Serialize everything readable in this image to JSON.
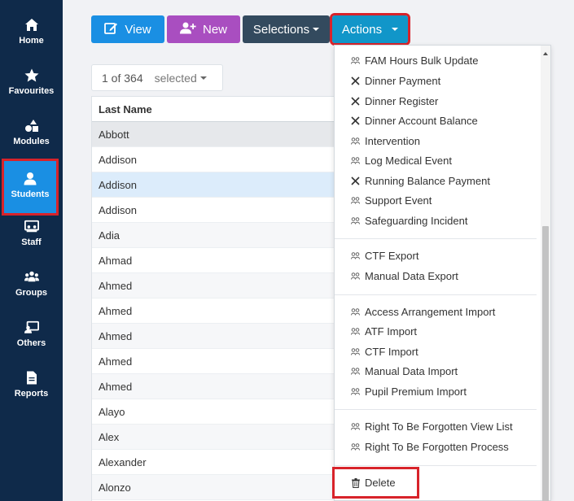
{
  "sidebar": {
    "items": [
      {
        "label": "Home",
        "icon": "home-icon"
      },
      {
        "label": "Favourites",
        "icon": "star-icon"
      },
      {
        "label": "Modules",
        "icon": "shapes-icon"
      },
      {
        "label": "Students",
        "icon": "user-icon",
        "active": true
      },
      {
        "label": "Staff",
        "icon": "staff-board-icon"
      },
      {
        "label": "Groups",
        "icon": "users-group-icon"
      },
      {
        "label": "Others",
        "icon": "monitor-user-icon"
      },
      {
        "label": "Reports",
        "icon": "document-icon"
      }
    ]
  },
  "toolbar": {
    "view_label": "View",
    "new_label": "New",
    "selections_label": "Selections",
    "actions_label": "Actions"
  },
  "selection": {
    "count": "1 of 364",
    "label": "selected"
  },
  "table": {
    "header": "Last Name",
    "rows": [
      "Abbott",
      "Addison",
      "Addison",
      "Addison",
      "Adia",
      "Ahmad",
      "Ahmed",
      "Ahmed",
      "Ahmed",
      "Ahmed",
      "Ahmed",
      "Alayo",
      "Alex",
      "Alexander",
      "Alonzo"
    ]
  },
  "actions_menu": {
    "groups": [
      [
        {
          "label": "FAM Hours Bulk Update",
          "icon": "users-icon"
        },
        {
          "label": "Dinner Payment",
          "icon": "cutlery-icon"
        },
        {
          "label": "Dinner Register",
          "icon": "cutlery-icon"
        },
        {
          "label": "Dinner Account Balance",
          "icon": "cutlery-icon"
        },
        {
          "label": "Intervention",
          "icon": "users-icon"
        },
        {
          "label": "Log Medical Event",
          "icon": "users-icon"
        },
        {
          "label": "Running Balance Payment",
          "icon": "cutlery-icon"
        },
        {
          "label": "Support Event",
          "icon": "users-icon"
        },
        {
          "label": "Safeguarding Incident",
          "icon": "users-icon"
        }
      ],
      [
        {
          "label": "CTF Export",
          "icon": "users-icon"
        },
        {
          "label": "Manual Data Export",
          "icon": "users-icon"
        }
      ],
      [
        {
          "label": "Access Arrangement Import",
          "icon": "users-icon"
        },
        {
          "label": "ATF Import",
          "icon": "users-icon"
        },
        {
          "label": "CTF Import",
          "icon": "users-icon"
        },
        {
          "label": "Manual Data Import",
          "icon": "users-icon"
        },
        {
          "label": "Pupil Premium Import",
          "icon": "users-icon"
        }
      ],
      [
        {
          "label": "Right To Be Forgotten View List",
          "icon": "users-icon"
        },
        {
          "label": "Right To Be Forgotten Process",
          "icon": "users-icon"
        }
      ]
    ],
    "delete_label": "Delete"
  },
  "colors": {
    "sidebar_bg": "#0f2a4a",
    "active_blue": "#1a8fe3",
    "new_purple": "#a94ec0",
    "selections_dark": "#334a5e",
    "actions_teal": "#1196c9",
    "highlight_red": "#d8232a"
  }
}
